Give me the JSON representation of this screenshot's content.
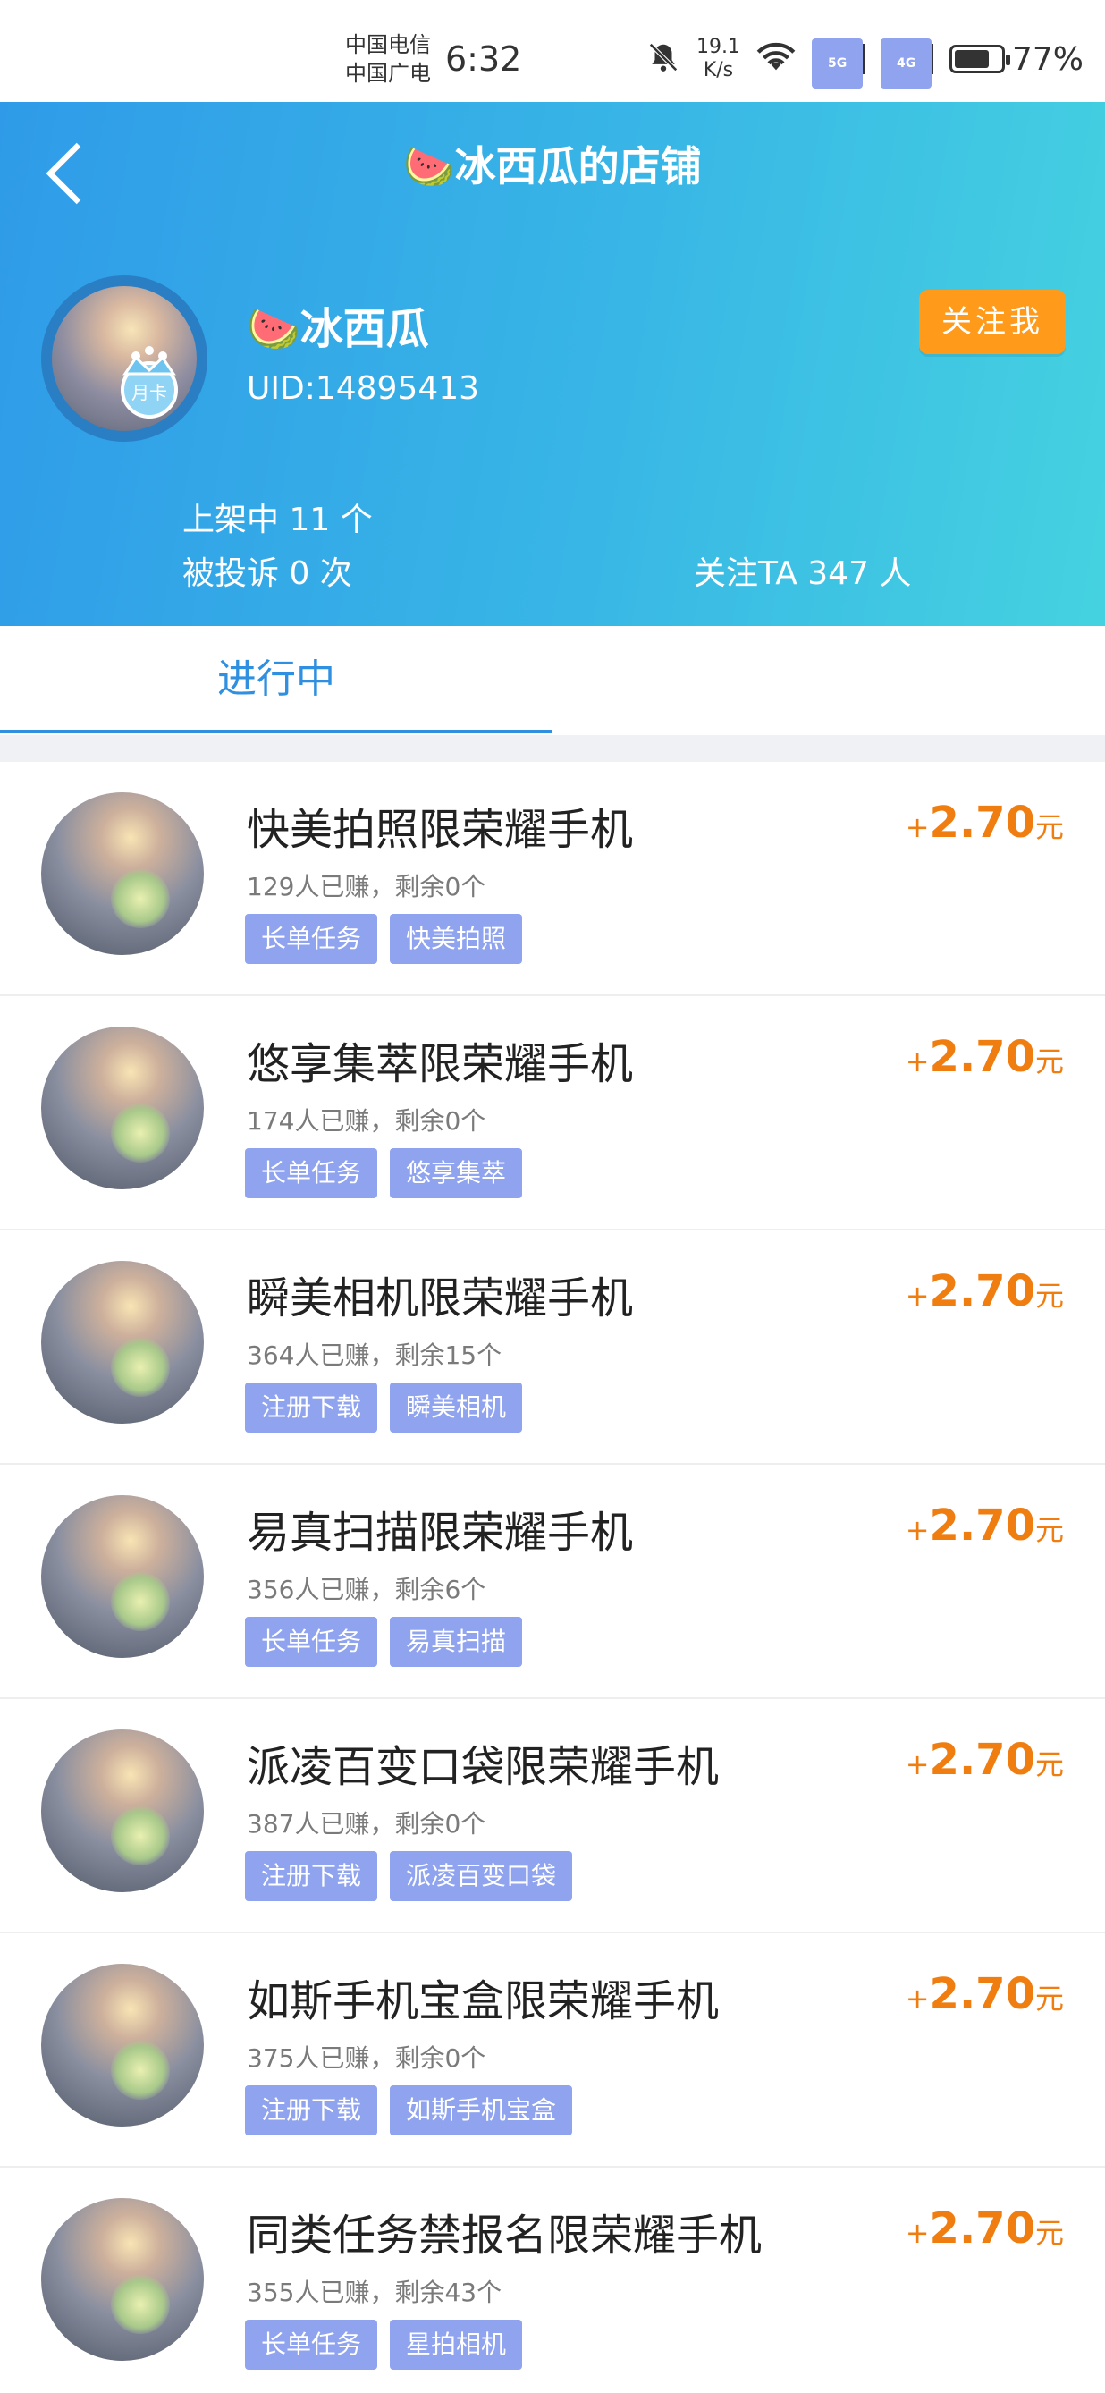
{
  "status_bar": {
    "carrier1": "中国电信",
    "carrier2": "中国广电",
    "time": "6:32",
    "speed_value": "19.1",
    "speed_unit": "K/s",
    "sig1_tag": "5G",
    "sig2_tag": "4G",
    "battery": "77%",
    "battery_level": 0.77
  },
  "header": {
    "title": "🍉冰西瓜的店铺",
    "user_name": "🍉冰西瓜",
    "uid": "UID:14895413",
    "badge": "月卡",
    "follow_label": "关注我",
    "listed": "上架中 11 个",
    "complaints": "被投诉 0 次",
    "followers": "关注TA 347 人"
  },
  "tabs": {
    "active_label": "进行中"
  },
  "tasks": [
    {
      "name": "快美拍照限荣耀手机",
      "meta": "129人已赚，剩余0个",
      "tags": [
        "长单任务",
        "快美拍照"
      ],
      "plus": "+",
      "price": "2.70",
      "unit": "元"
    },
    {
      "name": "悠享集萃限荣耀手机",
      "meta": "174人已赚，剩余0个",
      "tags": [
        "长单任务",
        "悠享集萃"
      ],
      "plus": "+",
      "price": "2.70",
      "unit": "元"
    },
    {
      "name": "瞬美相机限荣耀手机",
      "meta": "364人已赚，剩余15个",
      "tags": [
        "注册下载",
        "瞬美相机"
      ],
      "plus": "+",
      "price": "2.70",
      "unit": "元"
    },
    {
      "name": "易真扫描限荣耀手机",
      "meta": "356人已赚，剩余6个",
      "tags": [
        "长单任务",
        "易真扫描"
      ],
      "plus": "+",
      "price": "2.70",
      "unit": "元"
    },
    {
      "name": "派凌百变口袋限荣耀手机",
      "meta": "387人已赚，剩余0个",
      "tags": [
        "注册下载",
        "派凌百变口袋"
      ],
      "plus": "+",
      "price": "2.70",
      "unit": "元"
    },
    {
      "name": "如斯手机宝盒限荣耀手机",
      "meta": "375人已赚，剩余0个",
      "tags": [
        "注册下载",
        "如斯手机宝盒"
      ],
      "plus": "+",
      "price": "2.70",
      "unit": "元"
    },
    {
      "name": "同类任务禁报名限荣耀手机",
      "meta": "355人已赚，剩余43个",
      "tags": [
        "长单任务",
        "星拍相机"
      ],
      "plus": "+",
      "price": "2.70",
      "unit": "元"
    }
  ]
}
